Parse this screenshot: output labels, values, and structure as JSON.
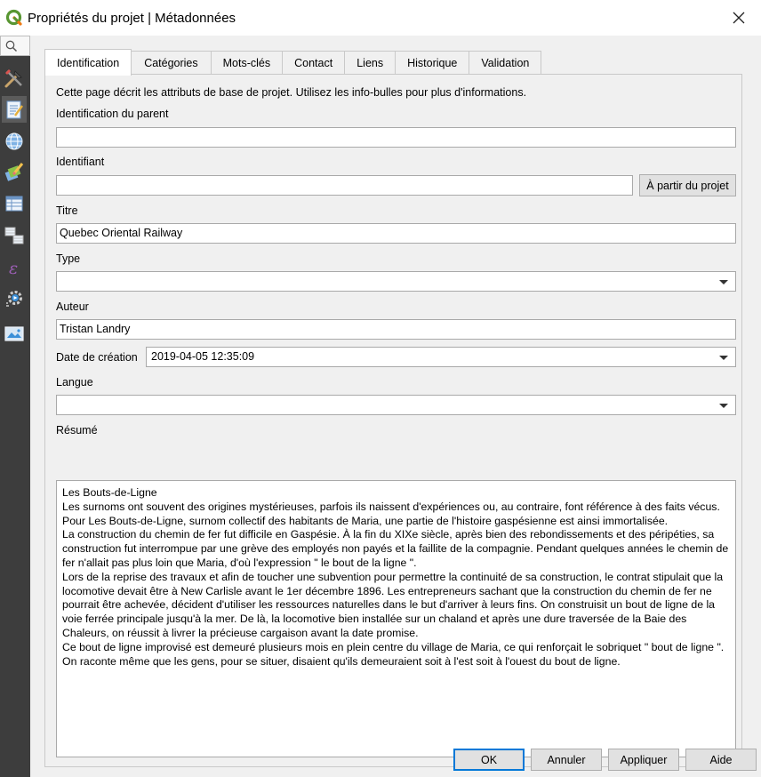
{
  "window": {
    "title": "Propriétés du projet | Métadonnées"
  },
  "sidebar": {
    "items": [
      {
        "icon": "general-settings-icon"
      },
      {
        "icon": "metadata-icon",
        "active": true
      },
      {
        "icon": "crs-globe-icon"
      },
      {
        "icon": "default-styles-icon"
      },
      {
        "icon": "data-sources-icon"
      },
      {
        "icon": "relations-icon"
      },
      {
        "icon": "variables-icon"
      },
      {
        "icon": "macros-icon"
      },
      {
        "icon": "qgis-server-icon"
      }
    ]
  },
  "tabs": [
    {
      "label": "Identification",
      "active": true
    },
    {
      "label": "Catégories"
    },
    {
      "label": "Mots-clés"
    },
    {
      "label": "Contact"
    },
    {
      "label": "Liens"
    },
    {
      "label": "Historique"
    },
    {
      "label": "Validation"
    }
  ],
  "form": {
    "description": "Cette page décrit les attributs de base de projet. Utilisez les info-bulles pour plus d'informations.",
    "parent_label": "Identification du parent",
    "parent_value": "",
    "identifier_label": "Identifiant",
    "identifier_value": "",
    "from_project_button": "À partir du projet",
    "title_label": "Titre",
    "title_value": "Quebec Oriental Railway",
    "type_label": "Type",
    "type_value": "",
    "author_label": "Auteur",
    "author_value": "Tristan Landry",
    "creation_date_label": "Date de création",
    "creation_date_value": "2019-04-05 12:35:09",
    "language_label": "Langue",
    "language_value": "",
    "abstract_label": "Résumé",
    "abstract_paragraphs": [
      "Les Bouts-de-Ligne",
      "Les surnoms ont souvent des origines mystérieuses, parfois ils naissent d'expériences ou, au contraire, font référence à des faits vécus. Pour Les Bouts-de-Ligne, surnom collectif des habitants de Maria, une partie de l'histoire gaspésienne est ainsi immortalisée.",
      "La construction du chemin de fer fut difficile en Gaspésie. À la fin du XIXe siècle, après bien des rebondissements et des péripéties, sa construction fut interrompue par une grève des employés non payés et la faillite de la compagnie. Pendant quelques années le chemin de fer n'allait pas plus loin que Maria, d'où l'expression \" le bout de la ligne \".",
      "Lors de la reprise des travaux et afin de toucher une subvention pour permettre la continuité de sa construction, le contrat stipulait que la locomotive devait être à New Carlisle avant le 1er décembre 1896. Les entrepreneurs sachant que la construction du chemin de fer ne pourrait être achevée, décident d'utiliser les ressources naturelles dans le but d'arriver à leurs fins. On construisit un bout de ligne de la voie ferrée principale jusqu'à la mer. De là, la locomotive bien installée sur un chaland et après une dure traversée de la Baie des Chaleurs, on réussit à livrer la précieuse cargaison avant la date promise.",
      "Ce bout de ligne improvisé est demeuré plusieurs mois en plein centre du village de Maria, ce qui renforçait le sobriquet \" bout de ligne \". On raconte même que les gens, pour se situer, disaient qu'ils demeuraient soit à l'est soit à l'ouest du bout de ligne."
    ]
  },
  "buttons": {
    "ok": "OK",
    "cancel": "Annuler",
    "apply": "Appliquer",
    "help": "Aide"
  },
  "colors": {
    "accent": "#0078d7",
    "sidebar": "#3d3d3d",
    "qgis_green": "#589632"
  }
}
